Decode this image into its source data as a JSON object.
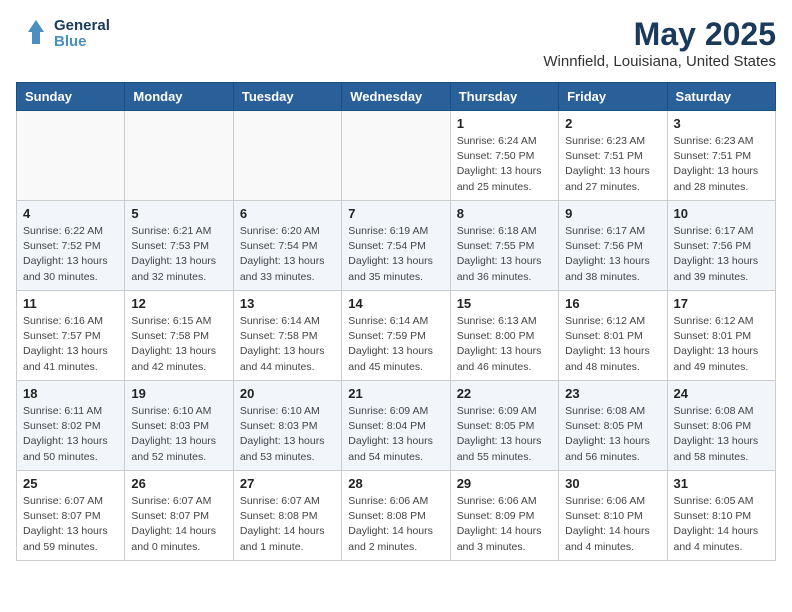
{
  "header": {
    "logo_line1": "General",
    "logo_line2": "Blue",
    "month": "May 2025",
    "location": "Winnfield, Louisiana, United States"
  },
  "weekdays": [
    "Sunday",
    "Monday",
    "Tuesday",
    "Wednesday",
    "Thursday",
    "Friday",
    "Saturday"
  ],
  "weeks": [
    [
      {
        "day": "",
        "sunrise": "",
        "sunset": "",
        "daylight": ""
      },
      {
        "day": "",
        "sunrise": "",
        "sunset": "",
        "daylight": ""
      },
      {
        "day": "",
        "sunrise": "",
        "sunset": "",
        "daylight": ""
      },
      {
        "day": "",
        "sunrise": "",
        "sunset": "",
        "daylight": ""
      },
      {
        "day": "1",
        "sunrise": "Sunrise: 6:24 AM",
        "sunset": "Sunset: 7:50 PM",
        "daylight": "Daylight: 13 hours and 25 minutes."
      },
      {
        "day": "2",
        "sunrise": "Sunrise: 6:23 AM",
        "sunset": "Sunset: 7:51 PM",
        "daylight": "Daylight: 13 hours and 27 minutes."
      },
      {
        "day": "3",
        "sunrise": "Sunrise: 6:23 AM",
        "sunset": "Sunset: 7:51 PM",
        "daylight": "Daylight: 13 hours and 28 minutes."
      }
    ],
    [
      {
        "day": "4",
        "sunrise": "Sunrise: 6:22 AM",
        "sunset": "Sunset: 7:52 PM",
        "daylight": "Daylight: 13 hours and 30 minutes."
      },
      {
        "day": "5",
        "sunrise": "Sunrise: 6:21 AM",
        "sunset": "Sunset: 7:53 PM",
        "daylight": "Daylight: 13 hours and 32 minutes."
      },
      {
        "day": "6",
        "sunrise": "Sunrise: 6:20 AM",
        "sunset": "Sunset: 7:54 PM",
        "daylight": "Daylight: 13 hours and 33 minutes."
      },
      {
        "day": "7",
        "sunrise": "Sunrise: 6:19 AM",
        "sunset": "Sunset: 7:54 PM",
        "daylight": "Daylight: 13 hours and 35 minutes."
      },
      {
        "day": "8",
        "sunrise": "Sunrise: 6:18 AM",
        "sunset": "Sunset: 7:55 PM",
        "daylight": "Daylight: 13 hours and 36 minutes."
      },
      {
        "day": "9",
        "sunrise": "Sunrise: 6:17 AM",
        "sunset": "Sunset: 7:56 PM",
        "daylight": "Daylight: 13 hours and 38 minutes."
      },
      {
        "day": "10",
        "sunrise": "Sunrise: 6:17 AM",
        "sunset": "Sunset: 7:56 PM",
        "daylight": "Daylight: 13 hours and 39 minutes."
      }
    ],
    [
      {
        "day": "11",
        "sunrise": "Sunrise: 6:16 AM",
        "sunset": "Sunset: 7:57 PM",
        "daylight": "Daylight: 13 hours and 41 minutes."
      },
      {
        "day": "12",
        "sunrise": "Sunrise: 6:15 AM",
        "sunset": "Sunset: 7:58 PM",
        "daylight": "Daylight: 13 hours and 42 minutes."
      },
      {
        "day": "13",
        "sunrise": "Sunrise: 6:14 AM",
        "sunset": "Sunset: 7:58 PM",
        "daylight": "Daylight: 13 hours and 44 minutes."
      },
      {
        "day": "14",
        "sunrise": "Sunrise: 6:14 AM",
        "sunset": "Sunset: 7:59 PM",
        "daylight": "Daylight: 13 hours and 45 minutes."
      },
      {
        "day": "15",
        "sunrise": "Sunrise: 6:13 AM",
        "sunset": "Sunset: 8:00 PM",
        "daylight": "Daylight: 13 hours and 46 minutes."
      },
      {
        "day": "16",
        "sunrise": "Sunrise: 6:12 AM",
        "sunset": "Sunset: 8:01 PM",
        "daylight": "Daylight: 13 hours and 48 minutes."
      },
      {
        "day": "17",
        "sunrise": "Sunrise: 6:12 AM",
        "sunset": "Sunset: 8:01 PM",
        "daylight": "Daylight: 13 hours and 49 minutes."
      }
    ],
    [
      {
        "day": "18",
        "sunrise": "Sunrise: 6:11 AM",
        "sunset": "Sunset: 8:02 PM",
        "daylight": "Daylight: 13 hours and 50 minutes."
      },
      {
        "day": "19",
        "sunrise": "Sunrise: 6:10 AM",
        "sunset": "Sunset: 8:03 PM",
        "daylight": "Daylight: 13 hours and 52 minutes."
      },
      {
        "day": "20",
        "sunrise": "Sunrise: 6:10 AM",
        "sunset": "Sunset: 8:03 PM",
        "daylight": "Daylight: 13 hours and 53 minutes."
      },
      {
        "day": "21",
        "sunrise": "Sunrise: 6:09 AM",
        "sunset": "Sunset: 8:04 PM",
        "daylight": "Daylight: 13 hours and 54 minutes."
      },
      {
        "day": "22",
        "sunrise": "Sunrise: 6:09 AM",
        "sunset": "Sunset: 8:05 PM",
        "daylight": "Daylight: 13 hours and 55 minutes."
      },
      {
        "day": "23",
        "sunrise": "Sunrise: 6:08 AM",
        "sunset": "Sunset: 8:05 PM",
        "daylight": "Daylight: 13 hours and 56 minutes."
      },
      {
        "day": "24",
        "sunrise": "Sunrise: 6:08 AM",
        "sunset": "Sunset: 8:06 PM",
        "daylight": "Daylight: 13 hours and 58 minutes."
      }
    ],
    [
      {
        "day": "25",
        "sunrise": "Sunrise: 6:07 AM",
        "sunset": "Sunset: 8:07 PM",
        "daylight": "Daylight: 13 hours and 59 minutes."
      },
      {
        "day": "26",
        "sunrise": "Sunrise: 6:07 AM",
        "sunset": "Sunset: 8:07 PM",
        "daylight": "Daylight: 14 hours and 0 minutes."
      },
      {
        "day": "27",
        "sunrise": "Sunrise: 6:07 AM",
        "sunset": "Sunset: 8:08 PM",
        "daylight": "Daylight: 14 hours and 1 minute."
      },
      {
        "day": "28",
        "sunrise": "Sunrise: 6:06 AM",
        "sunset": "Sunset: 8:08 PM",
        "daylight": "Daylight: 14 hours and 2 minutes."
      },
      {
        "day": "29",
        "sunrise": "Sunrise: 6:06 AM",
        "sunset": "Sunset: 8:09 PM",
        "daylight": "Daylight: 14 hours and 3 minutes."
      },
      {
        "day": "30",
        "sunrise": "Sunrise: 6:06 AM",
        "sunset": "Sunset: 8:10 PM",
        "daylight": "Daylight: 14 hours and 4 minutes."
      },
      {
        "day": "31",
        "sunrise": "Sunrise: 6:05 AM",
        "sunset": "Sunset: 8:10 PM",
        "daylight": "Daylight: 14 hours and 4 minutes."
      }
    ]
  ]
}
